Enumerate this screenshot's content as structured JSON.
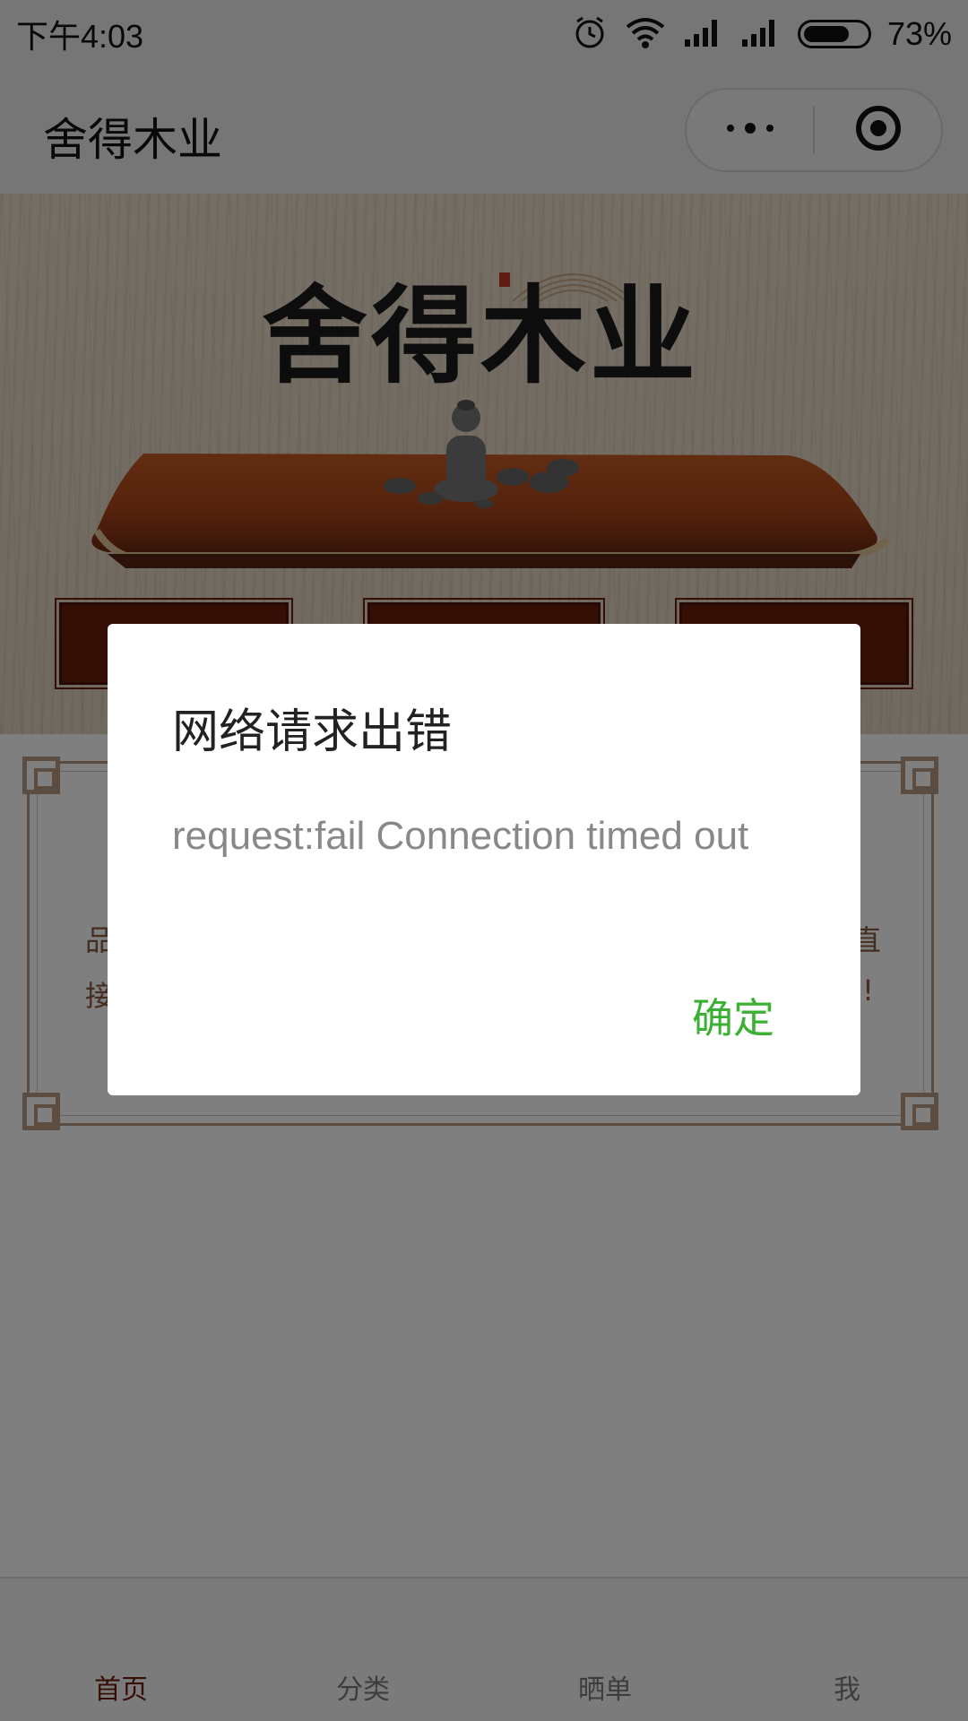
{
  "status_bar": {
    "time": "下午4:03",
    "battery_percent": "73%",
    "battery_level": 0.73,
    "icons": [
      "alarm-icon",
      "wifi-icon",
      "signal-icon",
      "signal-icon",
      "battery-icon"
    ]
  },
  "nav": {
    "title": "舍得木业",
    "menu_icon": "more-dots-icon",
    "close_icon": "close-target-icon"
  },
  "banner": {
    "logo_text": "舍得木业"
  },
  "content": {
    "frame_text_left_1": "品",
    "frame_text_left_2": "接",
    "frame_text_right_1": "直",
    "frame_text_right_2": "!"
  },
  "tabs": [
    {
      "label": "首页",
      "active": true
    },
    {
      "label": "分类",
      "active": false
    },
    {
      "label": "晒单",
      "active": false
    },
    {
      "label": "我",
      "active": false
    }
  ],
  "modal": {
    "title": "网络请求出错",
    "content": "request:fail Connection timed out",
    "confirm_label": "确定"
  },
  "colors": {
    "accent_green": "#3cb035",
    "brand_red": "#6b1e0d",
    "mask": "rgba(0,0,0,0.5)"
  }
}
